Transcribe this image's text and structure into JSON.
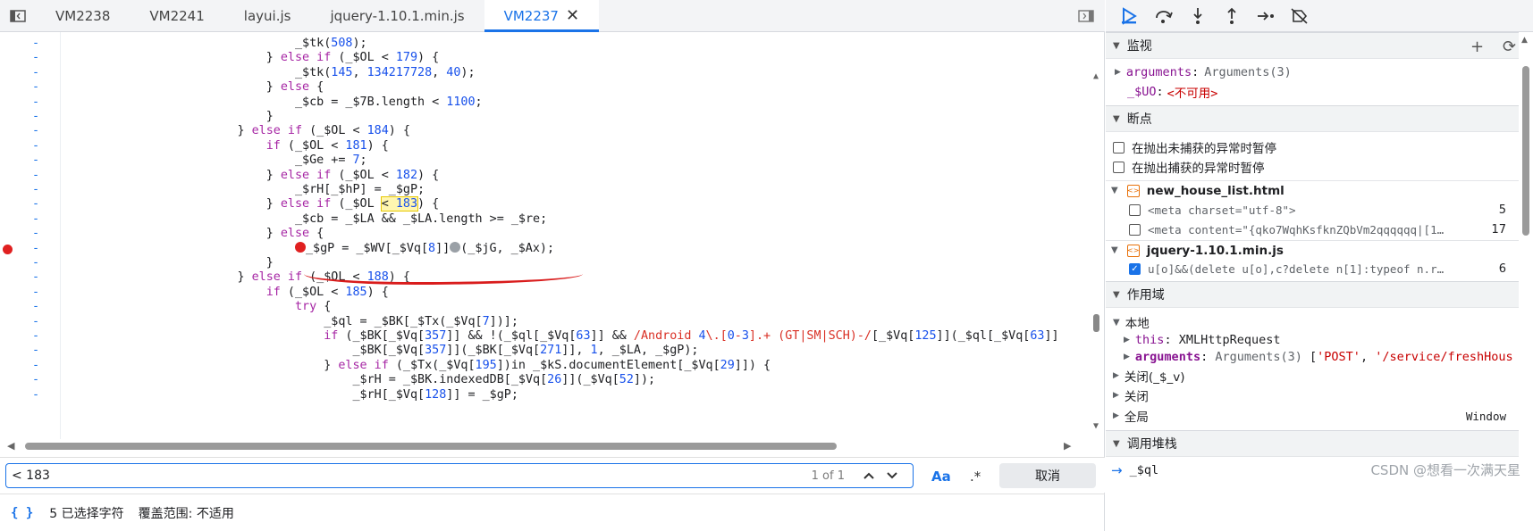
{
  "tabs": {
    "sidebar_toggle_icon": "sidebar-toggle-icon",
    "items": [
      {
        "label": "VM2238",
        "active": false
      },
      {
        "label": "VM2241",
        "active": false
      },
      {
        "label": "layui.js",
        "active": false
      },
      {
        "label": "jquery-1.10.1.min.js",
        "active": false
      },
      {
        "label": "VM2237",
        "active": true
      }
    ],
    "close_glyph": "✕"
  },
  "code": {
    "gutter_marker": "-",
    "lines": [
      "                                _$tk(508);",
      "                            } else if (_$OL < 179) {",
      "                                _$tk(145, 134217728, 40);",
      "                            } else {",
      "                                _$cb = _$7B.length < 1100;",
      "                            }",
      "                        } else if (_$OL < 184) {",
      "                            if (_$OL < 181) {",
      "                                _$Ge += 7;",
      "                            } else if (_$OL < 182) {",
      "                                _$rH[_$hP] = _$gP;",
      "                            } else if (_$OL < 183) {",
      "                                _$cb = _$LA && _$LA.length >= _$re;",
      "                            } else {",
      "                                _$gP = _$WV[_$Vq[8]](_$jG, _$Ax);",
      "                            }",
      "                        } else if (_$OL < 188) {",
      "                            if (_$OL < 185) {",
      "                                try {",
      "                                    _$ql = _$BK[_$Tx(_$Vq[7])];",
      "                                    if (_$BK[_$Vq[357]] && !(_$ql[_$Vq[63]] && /Android 4\\.[0-3].+ (GT|SM|SCH)-/[_$Vq[125]](_$ql[_$Vq[63]]",
      "                                        _$BK[_$Vq[357]](_$BK[_$Vq[271]], 1, _$LA, _$gP);",
      "                                    } else if (_$Tx(_$Vq[195])in _$kS.documentElement[_$Vq[29]]) {",
      "                                        _$rH = _$BK.indexedDB[_$Vq[26]](_$Vq[52]);",
      "                                        _$rH[_$Vq[128]] = _$gP;"
    ],
    "highlight_match": "< 183",
    "breakpoint_line_index": 14
  },
  "search": {
    "value": "< 183",
    "count": "1 of 1",
    "match_case_label": "Aa",
    "regex_label": ".*",
    "cancel_label": "取消"
  },
  "status": {
    "braces": "{ }",
    "selected": "5 已选择字符",
    "coverage": "覆盖范围: 不适用"
  },
  "debugger": {
    "watch": {
      "title": "监视",
      "add": "+",
      "refresh": "⟳",
      "rows": [
        {
          "name": "arguments",
          "sep": ":",
          "value": "Arguments(3)"
        },
        {
          "name": "_$UO",
          "sep": ":",
          "value": "<不可用>"
        }
      ]
    },
    "breakpoints": {
      "title": "断点",
      "options": [
        "在抛出未捕获的异常时暂停",
        "在抛出捕获的异常时暂停"
      ],
      "files": [
        {
          "name": "new_house_list.html",
          "items": [
            {
              "code": "<meta charset=\"utf-8\">",
              "line": "5",
              "checked": false
            },
            {
              "code": "<meta content=\"{qko7WqhKsfknZQbVm2qqqqqq|[1…",
              "line": "17",
              "checked": false
            }
          ]
        },
        {
          "name": "jquery-1.10.1.min.js",
          "items": [
            {
              "code": "u[o]&&(delete u[o],c?delete n[1]:typeof n.r…",
              "line": "6",
              "checked": true
            }
          ]
        }
      ]
    },
    "scope": {
      "title": "作用域",
      "local_label": "本地",
      "this_name": "this",
      "this_value": "XMLHttpRequest",
      "args_name": "arguments",
      "args_value": "Arguments(3)",
      "args_items": [
        "'POST'",
        "'/service/freshHous"
      ],
      "closure1": "关闭(_$_v)",
      "closure2": "关闭",
      "global_label": "全局",
      "global_value": "Window"
    },
    "callstack": {
      "title": "调用堆栈",
      "top_frame": "_$ql"
    },
    "watermark": "CSDN @想看一次满天星"
  }
}
